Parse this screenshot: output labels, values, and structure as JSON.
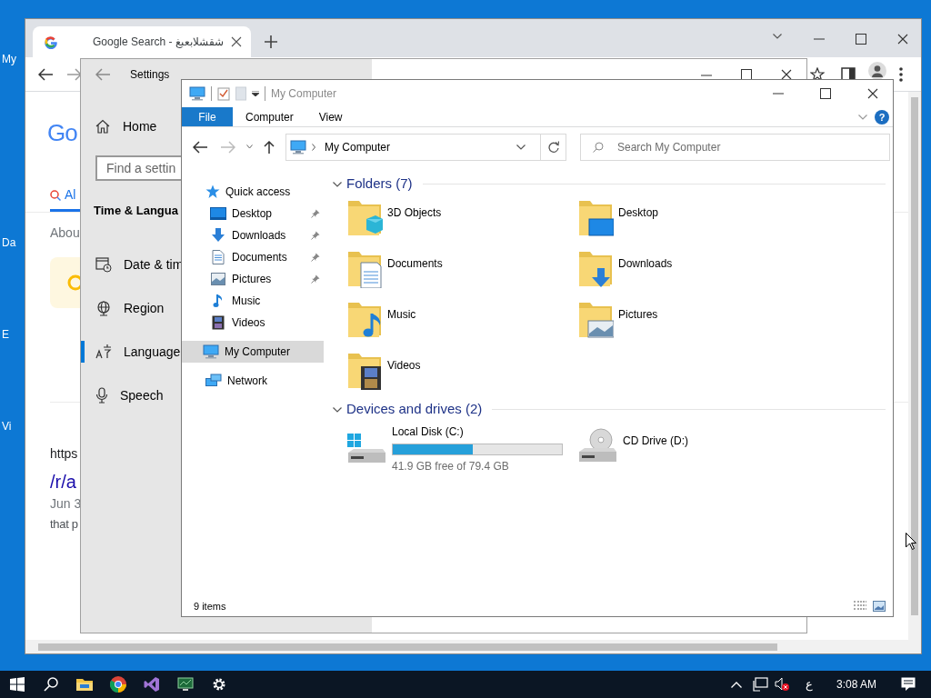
{
  "desktop": {
    "icon_labels": [
      "My",
      "Da",
      "E",
      "Vi"
    ]
  },
  "browser": {
    "tabs": [
      {
        "title": "Google Search - شقشلابعبغ",
        "selected": true
      }
    ],
    "page": {
      "logo": "Go",
      "result_tabs": [
        {
          "label": "Al",
          "selected": true
        }
      ],
      "stats": "Abou",
      "result": {
        "url": "https",
        "title": "/r/a",
        "date": "Jun 3",
        "snippet": "that p"
      }
    }
  },
  "settings": {
    "title": "Settings",
    "home": "Home",
    "search": {
      "placeholder": "Find a settin"
    },
    "section": "Time & Langua",
    "items": [
      {
        "label": "Date & tim",
        "selected": false
      },
      {
        "label": "Region",
        "selected": false
      },
      {
        "label": "Language",
        "selected": true
      },
      {
        "label": "Speech",
        "selected": false
      }
    ]
  },
  "explorer": {
    "title": "My Computer",
    "ribbon_tabs": [
      {
        "label": "File",
        "selected": true
      },
      {
        "label": "Computer",
        "selected": false
      },
      {
        "label": "View",
        "selected": false
      }
    ],
    "help": "?",
    "address": "My Computer",
    "search": {
      "placeholder": "Search My Computer"
    },
    "nav": [
      {
        "label": "Quick access",
        "selected": false,
        "children": [
          {
            "label": "Desktop",
            "pinned": true,
            "selected": false
          },
          {
            "label": "Downloads",
            "pinned": true,
            "selected": false
          },
          {
            "label": "Documents",
            "pinned": true,
            "selected": false
          },
          {
            "label": "Pictures",
            "pinned": true,
            "selected": false
          },
          {
            "label": "Music",
            "pinned": false,
            "selected": false
          },
          {
            "label": "Videos",
            "pinned": false,
            "selected": false
          }
        ]
      },
      {
        "label": "My Computer",
        "selected": true
      },
      {
        "label": "Network",
        "selected": false
      }
    ],
    "groups": [
      {
        "title": "Folders (7)",
        "expanded": true,
        "kind": "folders",
        "items": [
          {
            "name": "3D Objects"
          },
          {
            "name": "Desktop"
          },
          {
            "name": "Documents"
          },
          {
            "name": "Downloads"
          },
          {
            "name": "Music"
          },
          {
            "name": "Pictures"
          },
          {
            "name": "Videos"
          }
        ]
      },
      {
        "title": "Devices and drives (2)",
        "expanded": true,
        "kind": "drives",
        "items": [
          {
            "name": "Local Disk (C:)",
            "kind": "disk",
            "level": 0.472,
            "reading": "41.9 GB free of 79.4 GB"
          },
          {
            "name": "CD Drive (D:)",
            "kind": "optical"
          }
        ]
      }
    ],
    "status": "9 items"
  },
  "taskbar": {
    "input_language": "ع",
    "time": "3:08 AM"
  }
}
